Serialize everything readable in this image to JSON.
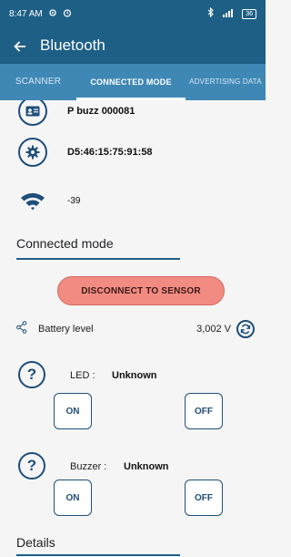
{
  "status_bar": {
    "time": "8:47 AM",
    "battery": "36"
  },
  "app_bar": {
    "title": "Bluetooth"
  },
  "tabs": [
    {
      "label": "SCANNER"
    },
    {
      "label": "CONNECTED MODE",
      "selected": true
    },
    {
      "label": "ADVERTISING DATA"
    }
  ],
  "device": {
    "name": "P buzz 000081",
    "address": "D5:46:15:75:91:58",
    "rssi": "-39"
  },
  "connected_mode": {
    "title": "Connected mode",
    "disconnect_label": "DISCONNECT TO SENSOR",
    "battery_label": "Battery level",
    "battery_value": "3,002 V"
  },
  "led": {
    "label": "LED :",
    "status": "Unknown",
    "on_label": "ON",
    "off_label": "OFF"
  },
  "buzzer": {
    "label": "Buzzer :",
    "status": "Unknown",
    "on_label": "ON",
    "off_label": "OFF"
  },
  "details": {
    "title": "Details"
  },
  "colors": {
    "primary": "#1e5f86",
    "tab_bar": "#3f88b6",
    "disconnect_bg": "#f28b82",
    "icon": "#1f4e7a"
  }
}
